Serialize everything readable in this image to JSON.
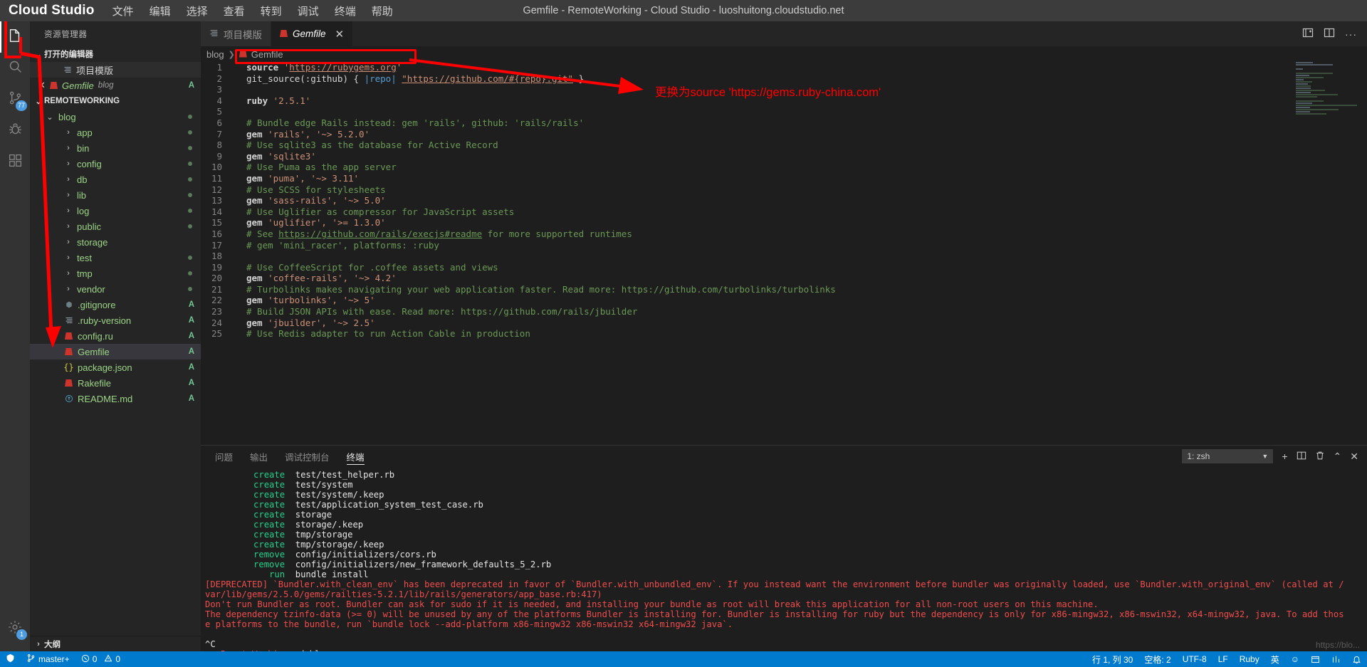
{
  "titlebar": {
    "brand": "Cloud Studio",
    "menus": [
      "文件",
      "编辑",
      "选择",
      "查看",
      "转到",
      "调试",
      "终端",
      "帮助"
    ],
    "window_title": "Gemfile - RemoteWorking - Cloud Studio - luoshuitong.cloudstudio.net"
  },
  "activitybar": {
    "items": [
      {
        "name": "explorer",
        "icon": "files-icon",
        "badge": ""
      },
      {
        "name": "search",
        "icon": "search-icon",
        "badge": ""
      },
      {
        "name": "source-control",
        "icon": "source-control-icon",
        "badge": "77"
      },
      {
        "name": "debug",
        "icon": "debug-icon",
        "badge": ""
      },
      {
        "name": "extensions",
        "icon": "extensions-icon",
        "badge": ""
      }
    ],
    "settings": {
      "icon": "gear-icon",
      "badge": "1"
    }
  },
  "sidebar": {
    "title": "资源管理器",
    "open_editors": {
      "label": "打开的编辑器",
      "items": [
        {
          "name": "项目模版",
          "icon": "list-icon",
          "sub": "",
          "git": "",
          "selected": true
        },
        {
          "name": "Gemfile",
          "icon": "ruby-icon",
          "sub": "blog",
          "git": "A",
          "selected": false,
          "closable": true
        }
      ]
    },
    "workspace": {
      "label": "REMOTEWORKING",
      "tree": [
        {
          "label": "blog",
          "type": "folder",
          "depth": 0,
          "expanded": true,
          "dot": true
        },
        {
          "label": "app",
          "type": "folder",
          "depth": 1,
          "expanded": false,
          "dot": true
        },
        {
          "label": "bin",
          "type": "folder",
          "depth": 1,
          "expanded": false,
          "dot": true
        },
        {
          "label": "config",
          "type": "folder",
          "depth": 1,
          "expanded": false,
          "dot": true
        },
        {
          "label": "db",
          "type": "folder",
          "depth": 1,
          "expanded": false,
          "dot": true
        },
        {
          "label": "lib",
          "type": "folder",
          "depth": 1,
          "expanded": false,
          "dot": true
        },
        {
          "label": "log",
          "type": "folder",
          "depth": 1,
          "expanded": false,
          "dot": true
        },
        {
          "label": "public",
          "type": "folder",
          "depth": 1,
          "expanded": false,
          "dot": true
        },
        {
          "label": "storage",
          "type": "folder",
          "depth": 1,
          "expanded": false,
          "dot": false
        },
        {
          "label": "test",
          "type": "folder",
          "depth": 1,
          "expanded": false,
          "dot": true
        },
        {
          "label": "tmp",
          "type": "folder",
          "depth": 1,
          "expanded": false,
          "dot": true
        },
        {
          "label": "vendor",
          "type": "folder",
          "depth": 1,
          "expanded": false,
          "dot": true
        },
        {
          "label": ".gitignore",
          "type": "file",
          "depth": 1,
          "icon": "config-icon",
          "git": "A"
        },
        {
          "label": ".ruby-version",
          "type": "file",
          "depth": 1,
          "icon": "list-icon",
          "git": "A"
        },
        {
          "label": "config.ru",
          "type": "file",
          "depth": 1,
          "icon": "ruby-icon",
          "git": "A"
        },
        {
          "label": "Gemfile",
          "type": "file",
          "depth": 1,
          "icon": "ruby-icon",
          "git": "A",
          "selected": true
        },
        {
          "label": "package.json",
          "type": "file",
          "depth": 1,
          "icon": "json-icon",
          "git": "A"
        },
        {
          "label": "Rakefile",
          "type": "file",
          "depth": 1,
          "icon": "ruby-icon",
          "git": "A"
        },
        {
          "label": "README.md",
          "type": "file",
          "depth": 1,
          "icon": "markdown-icon",
          "git": "A"
        }
      ]
    },
    "outline_label": "大纲"
  },
  "editor": {
    "tabs": [
      {
        "label": "项目模版",
        "icon": "list-icon",
        "active": false,
        "closable": false
      },
      {
        "label": "Gemfile",
        "icon": "ruby-icon",
        "active": true,
        "closable": true
      }
    ],
    "tab_actions": [
      "split-editor-icon",
      "layout-icon",
      "more-actions-icon"
    ],
    "breadcrumb": [
      "blog",
      "Gemfile"
    ],
    "lines": [
      {
        "n": 1,
        "tokens": [
          {
            "t": "source ",
            "c": "kw"
          },
          {
            "t": "'",
            "c": "str"
          },
          {
            "t": "https://rubygems.org",
            "c": "lnk"
          },
          {
            "t": "'",
            "c": "str"
          }
        ],
        "git": ""
      },
      {
        "n": 2,
        "tokens": [
          {
            "t": "git_source(:github) { ",
            "c": "pln"
          },
          {
            "t": "|repo|",
            "c": "var"
          },
          {
            "t": " ",
            "c": "pln"
          },
          {
            "t": "\"https://github.com/#{repo}.git\"",
            "c": "lnk"
          },
          {
            "t": " }",
            "c": "pln"
          }
        ],
        "git": "A"
      },
      {
        "n": 3,
        "tokens": [],
        "git": ""
      },
      {
        "n": 4,
        "tokens": [
          {
            "t": "ruby ",
            "c": "kw"
          },
          {
            "t": "'2.5.1'",
            "c": "str"
          }
        ],
        "git": ""
      },
      {
        "n": 5,
        "tokens": [],
        "git": "dot"
      },
      {
        "n": 6,
        "tokens": [
          {
            "t": "# Bundle edge Rails instead: gem 'rails', github: 'rails/rails'",
            "c": "cmt"
          }
        ],
        "git": "dot"
      },
      {
        "n": 7,
        "tokens": [
          {
            "t": "gem ",
            "c": "kw"
          },
          {
            "t": "'rails', '~> 5.2.0'",
            "c": "str"
          }
        ],
        "git": "dot"
      },
      {
        "n": 8,
        "tokens": [
          {
            "t": "# Use sqlite3 as the database for Active Record",
            "c": "cmt"
          }
        ],
        "git": "dot"
      },
      {
        "n": 9,
        "tokens": [
          {
            "t": "gem ",
            "c": "kw"
          },
          {
            "t": "'sqlite3'",
            "c": "str"
          }
        ],
        "git": "dot"
      },
      {
        "n": 10,
        "tokens": [
          {
            "t": "# Use Puma as the app server",
            "c": "cmt"
          }
        ],
        "git": "dot"
      },
      {
        "n": 11,
        "tokens": [
          {
            "t": "gem ",
            "c": "kw"
          },
          {
            "t": "'puma', '~> 3.11'",
            "c": "str"
          }
        ],
        "git": "dot"
      },
      {
        "n": 12,
        "tokens": [
          {
            "t": "# Use SCSS for stylesheets",
            "c": "cmt"
          }
        ],
        "git": "dot"
      },
      {
        "n": 13,
        "tokens": [
          {
            "t": "gem ",
            "c": "kw"
          },
          {
            "t": "'sass-rails', '~> 5.0'",
            "c": "str"
          }
        ],
        "git": "dot"
      },
      {
        "n": 14,
        "tokens": [
          {
            "t": "# Use Uglifier as compressor for JavaScript assets",
            "c": "cmt"
          }
        ],
        "git": ""
      },
      {
        "n": 15,
        "tokens": [
          {
            "t": "gem ",
            "c": "kw"
          },
          {
            "t": "'uglifier', '>= 1.3.0'",
            "c": "str"
          }
        ],
        "git": "dot"
      },
      {
        "n": 16,
        "tokens": [
          {
            "t": "# See ",
            "c": "cmt"
          },
          {
            "t": "https://github.com/rails/execjs#readme",
            "c": "lnkg"
          },
          {
            "t": " for more supported runtimes",
            "c": "cmt"
          }
        ],
        "git": "dot"
      },
      {
        "n": 17,
        "tokens": [
          {
            "t": "# gem 'mini_racer', platforms: :ruby",
            "c": "cmt"
          }
        ],
        "git": "dot"
      },
      {
        "n": 18,
        "tokens": [],
        "git": "A"
      },
      {
        "n": 19,
        "tokens": [
          {
            "t": "# Use CoffeeScript for .coffee assets and views",
            "c": "cmt"
          }
        ],
        "git": "A"
      },
      {
        "n": 20,
        "tokens": [
          {
            "t": "gem ",
            "c": "kw"
          },
          {
            "t": "'coffee-rails', '~> 4.2'",
            "c": "str"
          }
        ],
        "git": "A"
      },
      {
        "n": 21,
        "tokens": [
          {
            "t": "# Turbolinks makes navigating your web application faster. Read more: https://github.com/turbolinks/turbolinks",
            "c": "cmt"
          }
        ],
        "git": "A"
      },
      {
        "n": 22,
        "tokens": [
          {
            "t": "gem ",
            "c": "kw"
          },
          {
            "t": "'turbolinks', '~> 5'",
            "c": "str"
          }
        ],
        "git": "A"
      },
      {
        "n": 23,
        "tokens": [
          {
            "t": "# Build JSON APIs with ease. Read more: https://github.com/rails/jbuilder",
            "c": "cmt"
          }
        ],
        "git": "A"
      },
      {
        "n": 24,
        "tokens": [
          {
            "t": "gem ",
            "c": "kw"
          },
          {
            "t": "'jbuilder', '~> 2.5'",
            "c": "str"
          }
        ],
        "git": "A"
      },
      {
        "n": 25,
        "tokens": [
          {
            "t": "# Use Redis adapter to run Action Cable in production",
            "c": "cmt"
          }
        ],
        "git": "A"
      }
    ]
  },
  "annotation": {
    "callout_text": "更换为source 'https://gems.ruby-china.com'",
    "color": "#ff0000"
  },
  "panel": {
    "tabs": [
      "问题",
      "输出",
      "调试控制台",
      "终端"
    ],
    "active_tab": "终端",
    "terminal_select": "1: zsh",
    "actions": [
      "new-terminal-icon",
      "split-terminal-icon",
      "kill-terminal-icon",
      "chevron-up-icon",
      "close-icon"
    ],
    "terminal_lines": [
      {
        "indent": true,
        "parts": [
          {
            "t": "      create",
            "c": "t-green"
          },
          {
            "t": "  test/test_helper.rb",
            "c": "t-white"
          }
        ]
      },
      {
        "indent": true,
        "parts": [
          {
            "t": "      create",
            "c": "t-green"
          },
          {
            "t": "  test/system",
            "c": "t-white"
          }
        ]
      },
      {
        "indent": true,
        "parts": [
          {
            "t": "      create",
            "c": "t-green"
          },
          {
            "t": "  test/system/.keep",
            "c": "t-white"
          }
        ]
      },
      {
        "indent": true,
        "parts": [
          {
            "t": "      create",
            "c": "t-green"
          },
          {
            "t": "  test/application_system_test_case.rb",
            "c": "t-white"
          }
        ]
      },
      {
        "indent": true,
        "parts": [
          {
            "t": "      create",
            "c": "t-green"
          },
          {
            "t": "  storage",
            "c": "t-white"
          }
        ]
      },
      {
        "indent": true,
        "parts": [
          {
            "t": "      create",
            "c": "t-green"
          },
          {
            "t": "  storage/.keep",
            "c": "t-white"
          }
        ]
      },
      {
        "indent": true,
        "parts": [
          {
            "t": "      create",
            "c": "t-green"
          },
          {
            "t": "  tmp/storage",
            "c": "t-white"
          }
        ]
      },
      {
        "indent": true,
        "parts": [
          {
            "t": "      create",
            "c": "t-green"
          },
          {
            "t": "  tmp/storage/.keep",
            "c": "t-white"
          }
        ]
      },
      {
        "indent": true,
        "parts": [
          {
            "t": "      remove",
            "c": "t-green"
          },
          {
            "t": "  config/initializers/cors.rb",
            "c": "t-white"
          }
        ]
      },
      {
        "indent": true,
        "parts": [
          {
            "t": "      remove",
            "c": "t-green"
          },
          {
            "t": "  config/initializers/new_framework_defaults_5_2.rb",
            "c": "t-white"
          }
        ]
      },
      {
        "indent": true,
        "parts": [
          {
            "t": "         run",
            "c": "t-green"
          },
          {
            "t": "  bundle install",
            "c": "t-white"
          }
        ]
      },
      {
        "indent": false,
        "parts": [
          {
            "t": "[DEPRECATED] `Bundler.with_clean_env` has been deprecated in favor of `Bundler.with_unbundled_env`. If you instead want the environment before bundler was originally loaded, use `Bundler.with_original_env` (called at /",
            "c": "t-red"
          }
        ]
      },
      {
        "indent": false,
        "parts": [
          {
            "t": "var/lib/gems/2.5.0/gems/railties-5.2.1/lib/rails/generators/app_base.rb:417)",
            "c": "t-red"
          }
        ]
      },
      {
        "indent": false,
        "parts": [
          {
            "t": "Don't run Bundler as root. Bundler can ask for sudo if it is needed, and installing your bundle as root will break this application for all non-root users on this machine.",
            "c": "t-red"
          }
        ]
      },
      {
        "indent": false,
        "parts": [
          {
            "t": "The dependency tzinfo-data (>= 0) will be unused by any of the platforms Bundler is installing for. Bundler is installing for ruby but the dependency is only for x86-mingw32, x86-mswin32, x64-mingw32, java. To add thos",
            "c": "t-red"
          }
        ]
      },
      {
        "indent": false,
        "parts": [
          {
            "t": "e platforms to the bundle, run `bundle lock --add-platform x86-mingw32 x86-mswin32 x64-mingw32 java`.",
            "c": "t-red"
          }
        ]
      },
      {
        "indent": false,
        "parts": []
      },
      {
        "indent": false,
        "parts": [
          {
            "t": "^C",
            "c": "t-white"
          }
        ]
      },
      {
        "indent": false,
        "parts": [
          {
            "t": "➜ ",
            "c": "t-green"
          },
          {
            "t": " RemoteWorking",
            "c": "t-red"
          },
          {
            "t": " cd blog",
            "c": "t-white"
          }
        ]
      }
    ]
  },
  "statusbar": {
    "left": [
      {
        "icon": "remote-icon",
        "label": ""
      },
      {
        "icon": "branch-icon",
        "label": "master+"
      },
      {
        "icon": "error-icon",
        "label": "0"
      },
      {
        "icon": "warning-icon",
        "label": "0"
      }
    ],
    "right": [
      {
        "label": "行 1, 列 30"
      },
      {
        "label": "空格: 2"
      },
      {
        "label": "UTF-8"
      },
      {
        "label": "LF"
      },
      {
        "label": "Ruby"
      },
      {
        "label": "英"
      },
      {
        "icon": "bell-icon",
        "label": ""
      }
    ]
  },
  "watermark": "https://blo..."
}
